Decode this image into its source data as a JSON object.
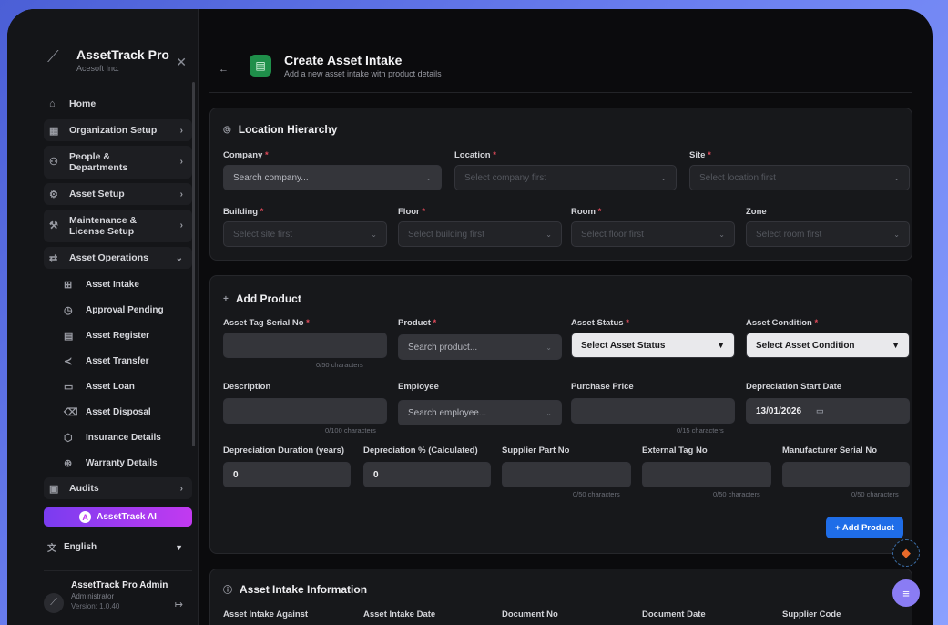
{
  "app": {
    "name": "AssetTrack Pro",
    "org": "Acesoft Inc."
  },
  "sidebar": {
    "items": [
      {
        "label": "Home",
        "icon": "home-icon"
      },
      {
        "label": "Organization Setup",
        "icon": "building-icon"
      },
      {
        "label": "People & Departments",
        "icon": "people-icon"
      },
      {
        "label": "Asset Setup",
        "icon": "gear-icon"
      },
      {
        "label": "Maintenance & License Setup",
        "icon": "wrench-icon"
      },
      {
        "label": "Asset Operations",
        "icon": "transfer-icon"
      }
    ],
    "sub_items": [
      {
        "label": "Asset Intake",
        "icon": "file-plus-icon"
      },
      {
        "label": "Approval Pending",
        "icon": "clock-icon"
      },
      {
        "label": "Asset Register",
        "icon": "clipboard-icon"
      },
      {
        "label": "Asset Transfer",
        "icon": "share-icon"
      },
      {
        "label": "Asset Loan",
        "icon": "card-icon"
      },
      {
        "label": "Asset Disposal",
        "icon": "trash-icon"
      },
      {
        "label": "Insurance Details",
        "icon": "shield-icon"
      },
      {
        "label": "Warranty Details",
        "icon": "badge-icon"
      }
    ],
    "audits": "Audits",
    "ai_button": "AssetTrack AI",
    "language": "English",
    "profile": {
      "name": "AssetTrack Pro Admin",
      "role": "Administrator",
      "version": "Version: 1.0.40"
    }
  },
  "header": {
    "title": "Create Asset Intake",
    "subtitle": "Add a new asset intake with product details"
  },
  "location": {
    "title": "Location Hierarchy",
    "company_label": "Company",
    "company_ph": "Search company...",
    "location_label": "Location",
    "location_ph": "Select company first",
    "site_label": "Site",
    "site_ph": "Select location first",
    "building_label": "Building",
    "building_ph": "Select site first",
    "floor_label": "Floor",
    "floor_ph": "Select building first",
    "room_label": "Room",
    "room_ph": "Select floor first",
    "zone_label": "Zone",
    "zone_ph": "Select room first"
  },
  "product": {
    "title": "Add Product",
    "tag_label": "Asset Tag Serial No",
    "tag_hint": "0/50 characters",
    "product_label": "Product",
    "product_ph": "Search product...",
    "status_label": "Asset Status",
    "status_value": "Select Asset Status",
    "condition_label": "Asset Condition",
    "condition_value": "Select Asset Condition",
    "description_label": "Description",
    "description_hint": "0/100 characters",
    "employee_label": "Employee",
    "employee_ph": "Search employee...",
    "price_label": "Purchase Price",
    "price_hint": "0/15 characters",
    "dep_start_label": "Depreciation Start Date",
    "dep_start_value": "13/01/2026",
    "dep_duration_label": "Depreciation Duration (years)",
    "dep_duration_value": "0",
    "dep_pct_label": "Depreciation % (Calculated)",
    "dep_pct_value": "0",
    "supplier_part_label": "Supplier Part No",
    "supplier_part_hint": "0/50 characters",
    "external_tag_label": "External Tag No",
    "external_tag_hint": "0/50 characters",
    "mfr_serial_label": "Manufacturer Serial No",
    "mfr_serial_hint": "0/50 characters",
    "add_button": "+ Add Product"
  },
  "intake": {
    "title": "Asset Intake Information",
    "columns": [
      "Asset Intake Against",
      "Asset Intake Date",
      "Document No",
      "Document Date",
      "Supplier Code"
    ]
  }
}
